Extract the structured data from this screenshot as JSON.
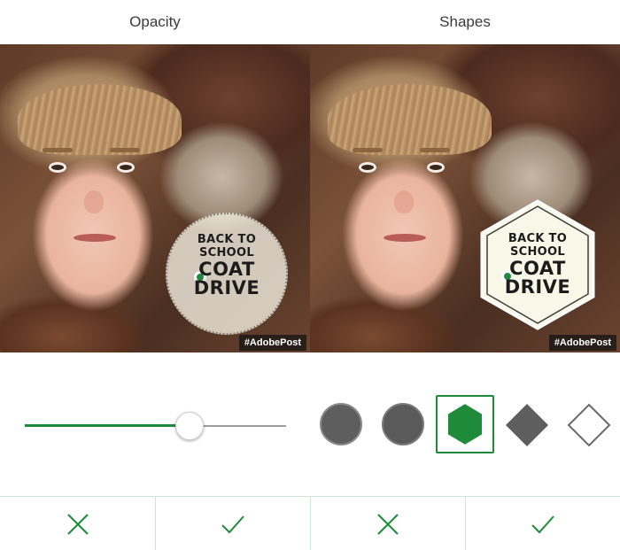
{
  "panels": [
    {
      "title": "Opacity",
      "hashtag": "#AdobePost",
      "badge": {
        "line1": "BACK TO",
        "line2": "SCHOOL",
        "line3": "COAT",
        "line4": "DRIVE"
      },
      "slider": {
        "value_fraction": 0.63
      }
    },
    {
      "title": "Shapes",
      "hashtag": "#AdobePost",
      "badge": {
        "line1": "BACK TO",
        "line2": "SCHOOL",
        "line3": "COAT",
        "line4": "DRIVE"
      },
      "shapes": [
        {
          "name": "circle",
          "selected": false
        },
        {
          "name": "circle-outline",
          "selected": false
        },
        {
          "name": "hexagon",
          "selected": true
        },
        {
          "name": "diamond-filled",
          "selected": false
        },
        {
          "name": "diamond-outline",
          "selected": false
        }
      ]
    }
  ],
  "bottom_bar": [
    {
      "icon": "close-icon"
    },
    {
      "icon": "checkmark-icon"
    },
    {
      "icon": "close-icon"
    },
    {
      "icon": "checkmark-icon"
    }
  ],
  "colors": {
    "accent": "#1f8a3a",
    "shape_gray": "#5e5e5e",
    "divider": "#cfe3d8"
  }
}
